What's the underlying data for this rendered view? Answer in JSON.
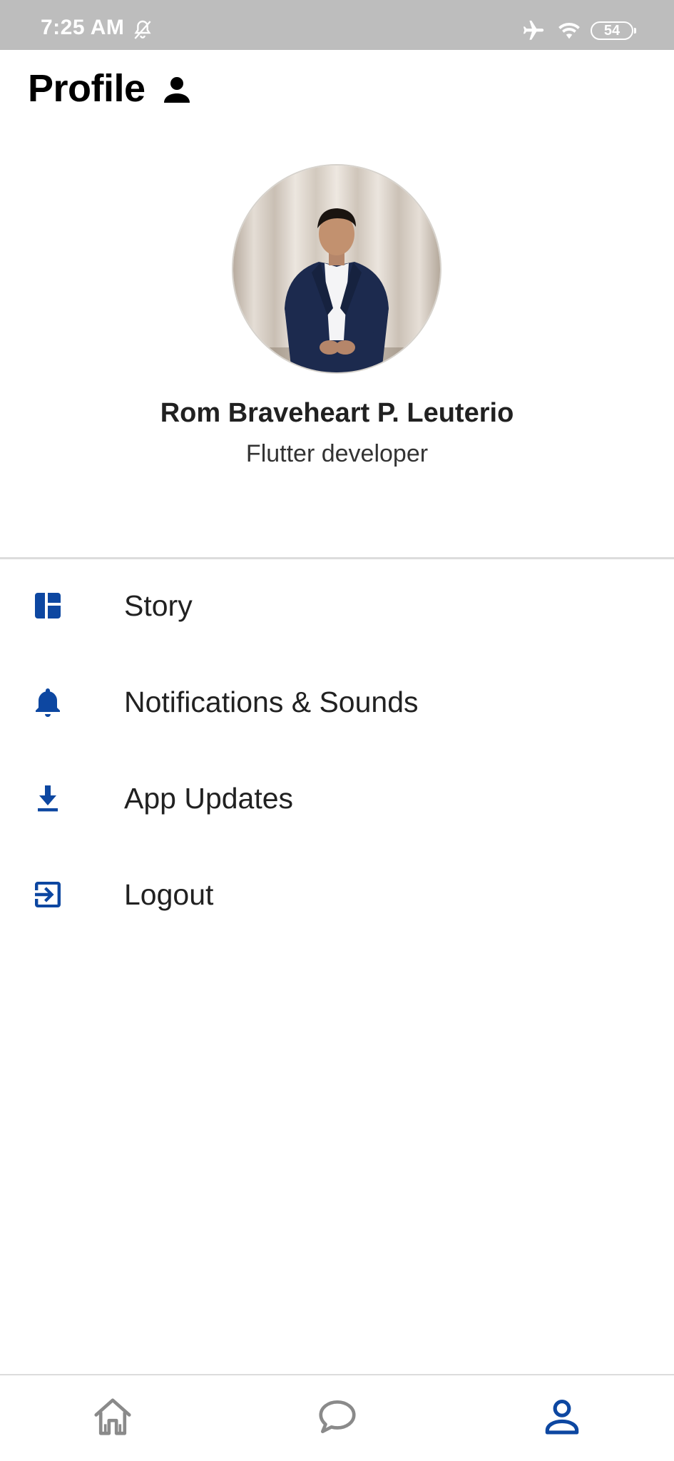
{
  "status_bar": {
    "time": "7:25 AM",
    "battery": "54",
    "icons": [
      "notifications-off-icon",
      "airplane-mode-icon",
      "wifi-icon",
      "battery-icon"
    ]
  },
  "header": {
    "title": "Profile",
    "icon": "person-icon"
  },
  "profile": {
    "name": "Rom Braveheart P. Leuterio",
    "role": "Flutter developer",
    "avatar": "profile-photo"
  },
  "menu": {
    "items": [
      {
        "label": "Story",
        "icon": "dashboard-icon"
      },
      {
        "label": "Notifications & Sounds",
        "icon": "bell-icon"
      },
      {
        "label": "App Updates",
        "icon": "download-icon"
      },
      {
        "label": "Logout",
        "icon": "exit-to-app-icon"
      }
    ]
  },
  "bottom_nav": {
    "items": [
      {
        "name": "home",
        "icon": "home-icon",
        "active": false
      },
      {
        "name": "chat",
        "icon": "chat-bubble-icon",
        "active": false
      },
      {
        "name": "profile",
        "icon": "person-outline-icon",
        "active": true
      }
    ]
  },
  "colors": {
    "accent": "#0d47a1",
    "inactive_nav": "#8a8a8a",
    "status_bar": "#bdbdbd",
    "text": "#212121"
  }
}
